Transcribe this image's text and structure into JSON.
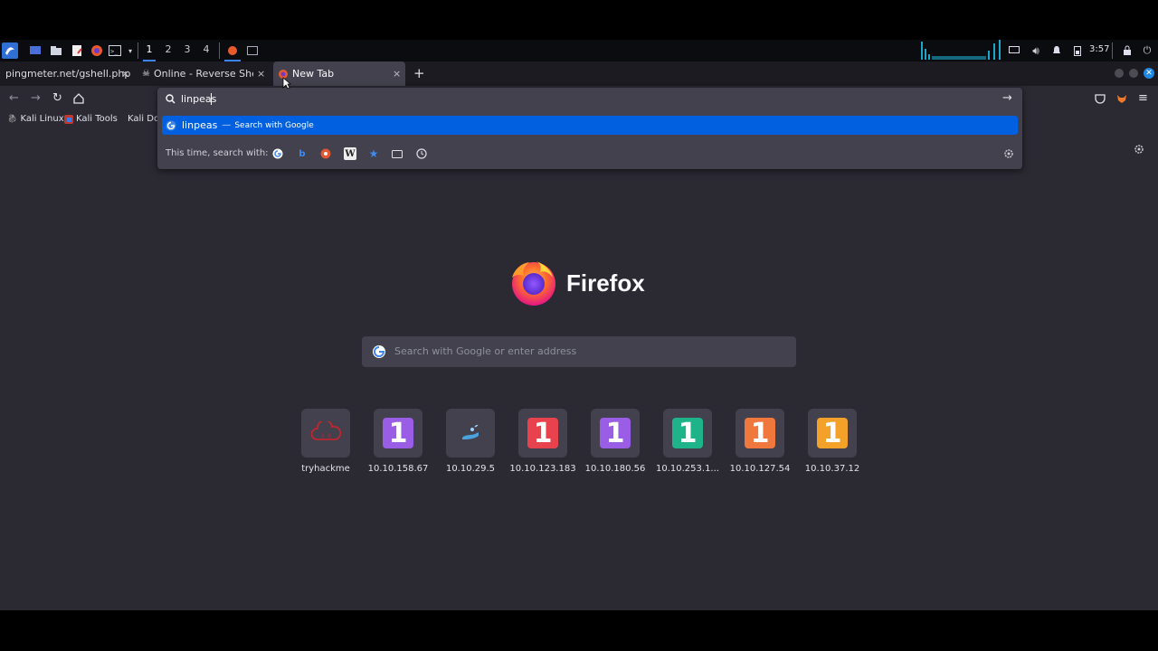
{
  "taskbar": {
    "workspaces": [
      "1",
      "2",
      "3",
      "4"
    ],
    "clock": "3:57",
    "colors": {
      "accent": "#3b82f6",
      "graph": "#1aa7c9"
    }
  },
  "tabs": [
    {
      "title": "pingmeter.net/gshell.php",
      "close": "×"
    },
    {
      "title": "Online - Reverse Shell Ge",
      "close": "×"
    },
    {
      "title": "New Tab",
      "close": "×"
    }
  ],
  "new_tab_symbol": "+",
  "bookmarks": [
    "Kali Linux",
    "Kali Tools",
    "Kali Do"
  ],
  "urlbar": {
    "value": "linpeas",
    "suggestion": {
      "query": "linpeas",
      "separator": "—",
      "action": "Search with Google"
    },
    "one_off_label": "This time, search with:",
    "engines": [
      "google-icon",
      "bing-icon",
      "duckduckgo-icon",
      "wikipedia-icon",
      "bookmarks-icon",
      "tabs-icon",
      "history-icon"
    ]
  },
  "newtab": {
    "brand": "Firefox",
    "search_placeholder": "Search with Google or enter address",
    "top_sites": [
      {
        "label": "tryhackme",
        "icon": "tryhackme-icon"
      },
      {
        "label": "10.10.158.67",
        "icon": "one-icon",
        "color": "#9a5de6"
      },
      {
        "label": "10.10.29.5",
        "icon": "hand-icon"
      },
      {
        "label": "10.10.123.183",
        "icon": "one-icon",
        "color": "#e8424e"
      },
      {
        "label": "10.10.180.56",
        "icon": "one-icon",
        "color": "#9a5de6"
      },
      {
        "label": "10.10.253.1...",
        "icon": "one-icon",
        "color": "#1fb38a"
      },
      {
        "label": "10.10.127.54",
        "icon": "one-icon",
        "color": "#f0783c"
      },
      {
        "label": "10.10.37.12",
        "icon": "one-icon",
        "color": "#f4a12a"
      }
    ]
  }
}
